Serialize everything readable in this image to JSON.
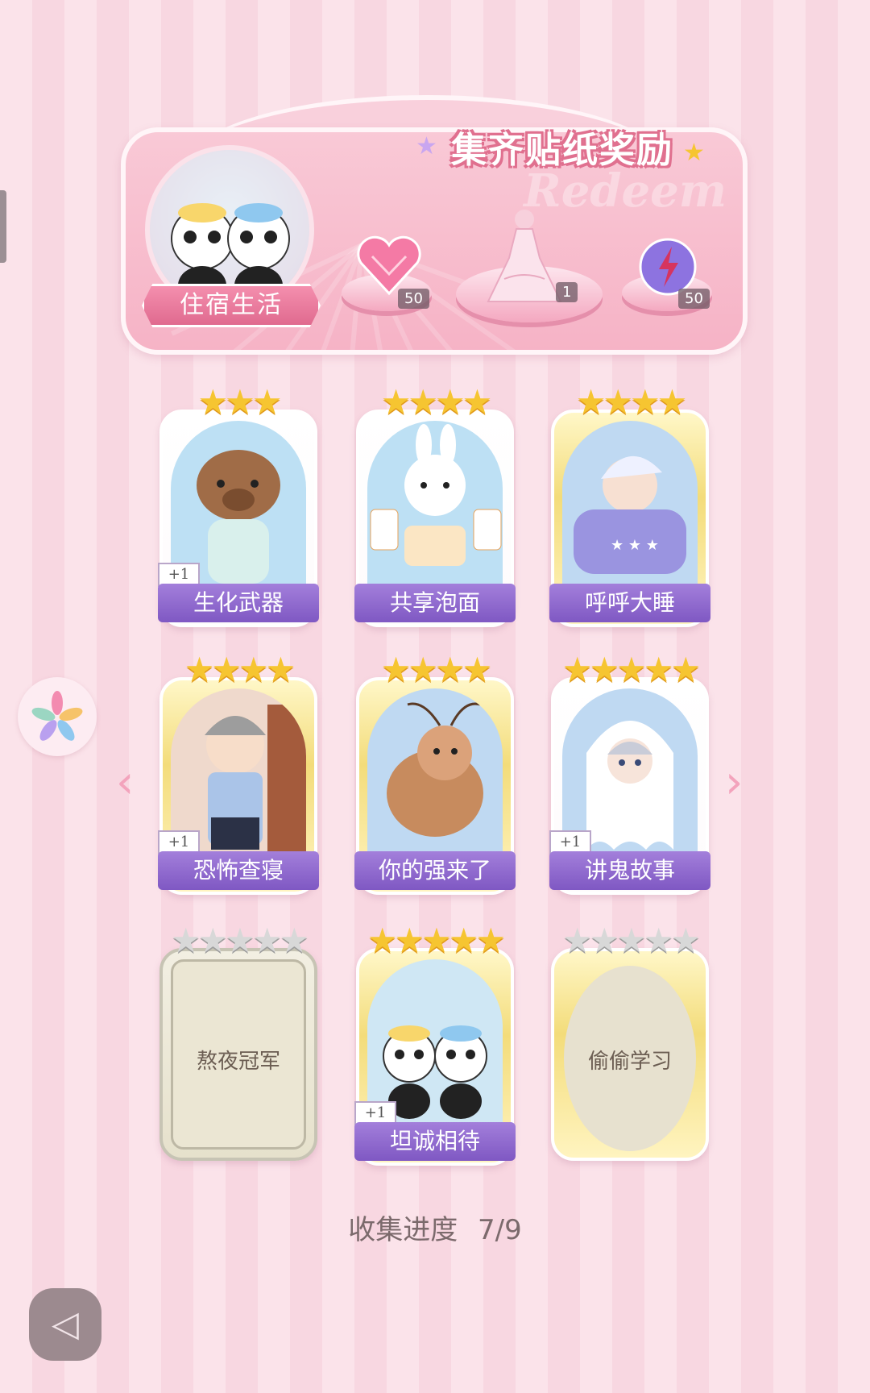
{
  "banner": {
    "title": "集齐贴纸奖励",
    "watermark": "Redeem",
    "theme_label": "住宿生活",
    "rewards": [
      {
        "icon": "heart-gem-icon",
        "count": "50"
      },
      {
        "icon": "dress-outfit-icon",
        "count": "1"
      },
      {
        "icon": "energy-orb-icon",
        "count": "50"
      }
    ]
  },
  "cards": [
    {
      "name": "生化武器",
      "stars": 3,
      "badge": "+1",
      "state": "collected"
    },
    {
      "name": "共享泡面",
      "stars": 4,
      "badge": "",
      "state": "collected"
    },
    {
      "name": "呼呼大睡",
      "stars": 4,
      "badge": "",
      "state": "collected"
    },
    {
      "name": "恐怖查寝",
      "stars": 4,
      "badge": "+1",
      "state": "collected"
    },
    {
      "name": "你的强来了",
      "stars": 4,
      "badge": "",
      "state": "collected"
    },
    {
      "name": "讲鬼故事",
      "stars": 5,
      "badge": "+1",
      "state": "collected"
    },
    {
      "name": "熬夜冠军",
      "stars": 5,
      "badge": "",
      "state": "locked"
    },
    {
      "name": "坦诚相待",
      "stars": 5,
      "badge": "+1",
      "state": "collected"
    },
    {
      "name": "偷偷学习",
      "stars": 5,
      "badge": "",
      "state": "locked"
    }
  ],
  "progress": {
    "label": "收集进度",
    "value": "7/9"
  },
  "colors": {
    "accent": "#8a62c8",
    "star": "#f6c531",
    "pink": "#f4a8c0"
  }
}
